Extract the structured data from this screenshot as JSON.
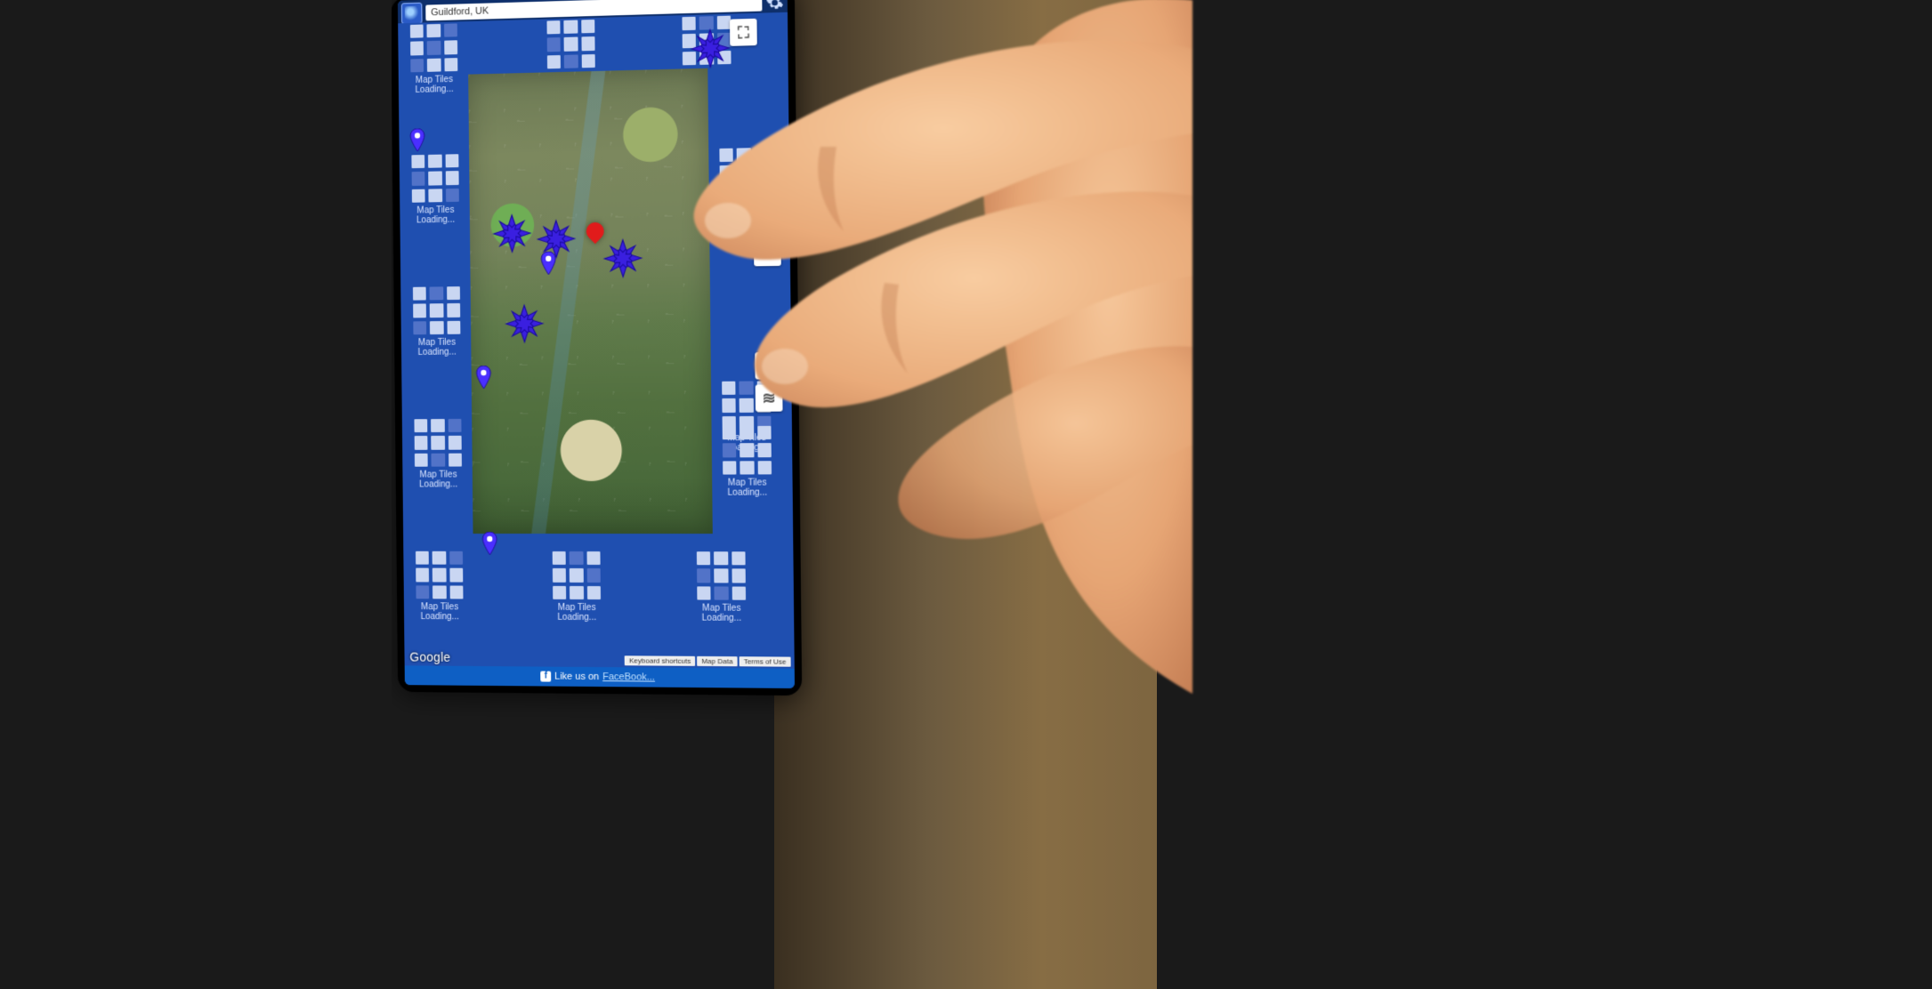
{
  "search": {
    "value": "Guildford, UK"
  },
  "tile_label": "Map Tiles Loading...",
  "controls": {
    "fullscreen": "⛶",
    "zoom_in": "+",
    "zoom_out": "−",
    "locate": "◎",
    "layers": "≋"
  },
  "footer": {
    "attribution": "Google",
    "links": [
      "Keyboard shortcuts",
      "Map Data",
      "Terms of Use"
    ]
  },
  "bottombar": {
    "prefix": "Like us on ",
    "link": "FaceBook..."
  },
  "markers": {
    "center": {
      "type": "red"
    },
    "clusters": 5,
    "pins": 4
  },
  "colors": {
    "screen_bg": "#1e4fa3",
    "cluster": "#3a1fe0",
    "pin": "#4a2fff",
    "red": "#e11b1b"
  }
}
